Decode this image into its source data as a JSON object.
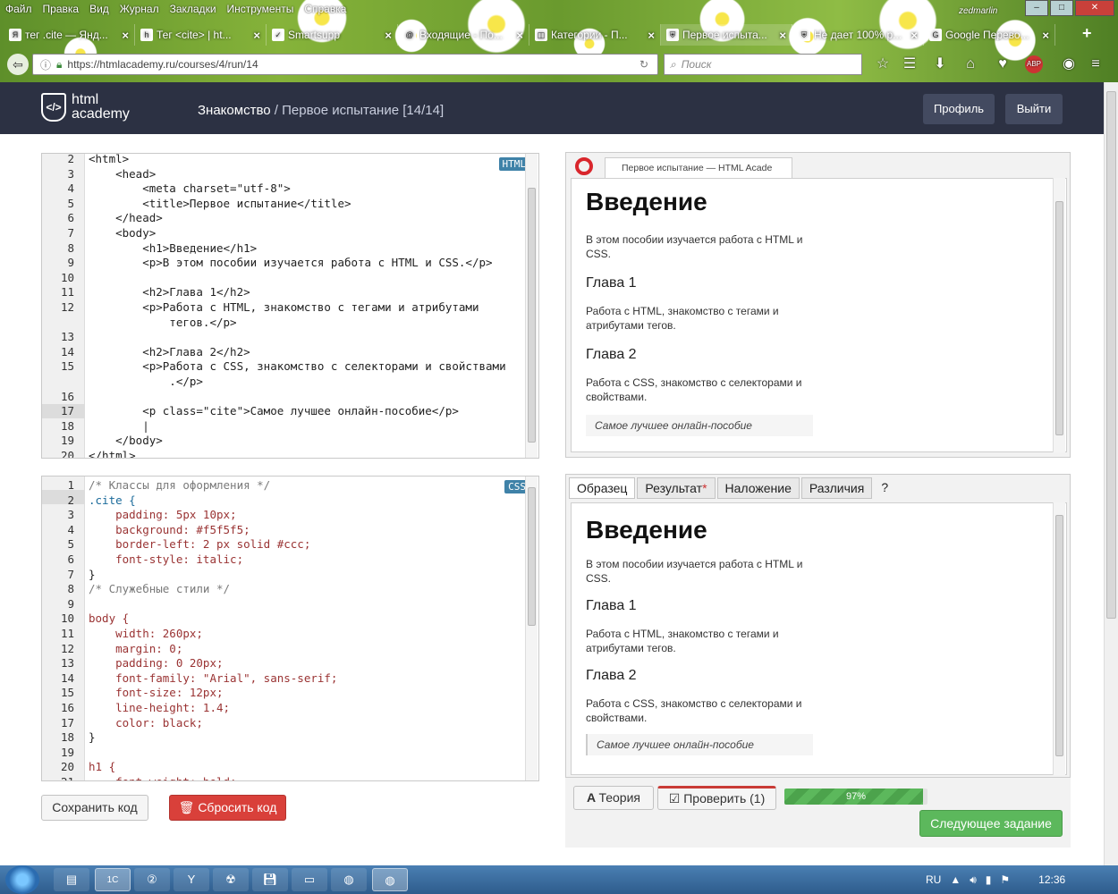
{
  "browser": {
    "menu": [
      "Файл",
      "Правка",
      "Вид",
      "Журнал",
      "Закладки",
      "Инструменты",
      "Справка"
    ],
    "profile_name": "zedmarlin",
    "tabs": [
      {
        "label": "тег .cite — Янд...",
        "icon": "Я"
      },
      {
        "label": "Тег <cite> | ht...",
        "icon": "h"
      },
      {
        "label": "Smartsupp",
        "icon": "✓"
      },
      {
        "label": "Входящие - По...",
        "icon": "@"
      },
      {
        "label": "Категории - П...",
        "icon": "◫"
      },
      {
        "label": "Первое испыта...",
        "icon": "⛨"
      },
      {
        "label": "Не дает 100% р...",
        "icon": "⛨"
      },
      {
        "label": "Google Перево...",
        "icon": "G"
      }
    ],
    "url": "https://htmlacademy.ru/courses/4/run/14",
    "search_placeholder": "Поиск"
  },
  "site": {
    "logo_line1": "html",
    "logo_line2": "academy",
    "breadcrumb_section": "Знакомство",
    "breadcrumb_sep": " / ",
    "breadcrumb_task": "Первое испытание",
    "breadcrumb_progress": "[14/14]",
    "profile_button": "Профиль",
    "logout_button": "Выйти"
  },
  "html_editor": {
    "badge": "HTML",
    "lines": [
      {
        "n": "2",
        "code": "<html>"
      },
      {
        "n": "3",
        "code": "    <head>"
      },
      {
        "n": "4",
        "code": "        <meta charset=\"utf-8\">"
      },
      {
        "n": "5",
        "code": "        <title>Первое испытание</title>"
      },
      {
        "n": "6",
        "code": "    </head>"
      },
      {
        "n": "7",
        "code": "    <body>"
      },
      {
        "n": "8",
        "code": "        <h1>Введение</h1>"
      },
      {
        "n": "9",
        "code": "        <p>В этом пособии изучается работа с HTML и CSS.</p>"
      },
      {
        "n": "10",
        "code": ""
      },
      {
        "n": "11",
        "code": "        <h2>Глава 1</h2>"
      },
      {
        "n": "12",
        "code": "        <p>Работа с HTML, знакомство с тегами и атрибутами"
      },
      {
        "n": "",
        "code": "            тегов.</p>"
      },
      {
        "n": "13",
        "code": ""
      },
      {
        "n": "14",
        "code": "        <h2>Глава 2</h2>"
      },
      {
        "n": "15",
        "code": "        <p>Работа с CSS, знакомство с селекторами и свойствами"
      },
      {
        "n": "",
        "code": "            .</p>"
      },
      {
        "n": "16",
        "code": ""
      },
      {
        "n": "17",
        "code": "        <p class=\"cite\">Самое лучшее онлайн-пособие</p>"
      },
      {
        "n": "18",
        "code": "        |"
      },
      {
        "n": "19",
        "code": "    </body>"
      },
      {
        "n": "20",
        "code": "</html>"
      }
    ]
  },
  "css_editor": {
    "badge": "CSS",
    "lines": [
      {
        "n": "1",
        "code": "/* Классы для оформления */",
        "cls": "cm"
      },
      {
        "n": "2",
        "code": ".cite {",
        "cls": "sel"
      },
      {
        "n": "3",
        "code": "    padding: 5px 10px;",
        "cls": "prop"
      },
      {
        "n": "4",
        "code": "    background: #f5f5f5;",
        "cls": "prop"
      },
      {
        "n": "5",
        "code": "    border-left: 2 px solid #ccc;",
        "cls": "prop"
      },
      {
        "n": "6",
        "code": "    font-style: italic;",
        "cls": "prop"
      },
      {
        "n": "7",
        "code": "}",
        "cls": "tag"
      },
      {
        "n": "8",
        "code": "/* Служебные стили */",
        "cls": "cm"
      },
      {
        "n": "9",
        "code": "",
        "cls": "tag"
      },
      {
        "n": "10",
        "code": "body {",
        "cls": "prop"
      },
      {
        "n": "11",
        "code": "    width: 260px;",
        "cls": "prop"
      },
      {
        "n": "12",
        "code": "    margin: 0;",
        "cls": "prop"
      },
      {
        "n": "13",
        "code": "    padding: 0 20px;",
        "cls": "prop"
      },
      {
        "n": "14",
        "code": "    font-family: \"Arial\", sans-serif;",
        "cls": "prop"
      },
      {
        "n": "15",
        "code": "    font-size: 12px;",
        "cls": "prop"
      },
      {
        "n": "16",
        "code": "    line-height: 1.4;",
        "cls": "prop"
      },
      {
        "n": "17",
        "code": "    color: black;",
        "cls": "prop"
      },
      {
        "n": "18",
        "code": "}",
        "cls": "tag"
      },
      {
        "n": "19",
        "code": "",
        "cls": "tag"
      },
      {
        "n": "20",
        "code": "h1 {",
        "cls": "prop"
      },
      {
        "n": "21",
        "code": "    font-weight: bold;",
        "cls": "prop"
      }
    ]
  },
  "preview": {
    "tab_title": "Первое испытание — HTML Acade",
    "h1": "Введение",
    "p1": "В этом пособии изучается работа с HTML и CSS.",
    "h2a": "Глава 1",
    "p2": "Работа с HTML, знакомство с тегами и атрибутами тегов.",
    "h2b": "Глава 2",
    "p3": "Работа с CSS, знакомство с селекторами и свойствами.",
    "cite": "Самое лучшее онлайн-пособие"
  },
  "compare": {
    "tabs": [
      "Образец",
      "Результат",
      "Наложение",
      "Различия",
      "?"
    ],
    "result_marker": "*"
  },
  "actions": {
    "save": "Сохранить код",
    "reset": "Сбросить код",
    "theory": "Теория",
    "check": "Проверить (1)",
    "progress_label": "97%",
    "progress_fraction": 0.97,
    "next": "Следующее задание"
  },
  "taskbar": {
    "lang": "RU",
    "time": "12:36"
  }
}
